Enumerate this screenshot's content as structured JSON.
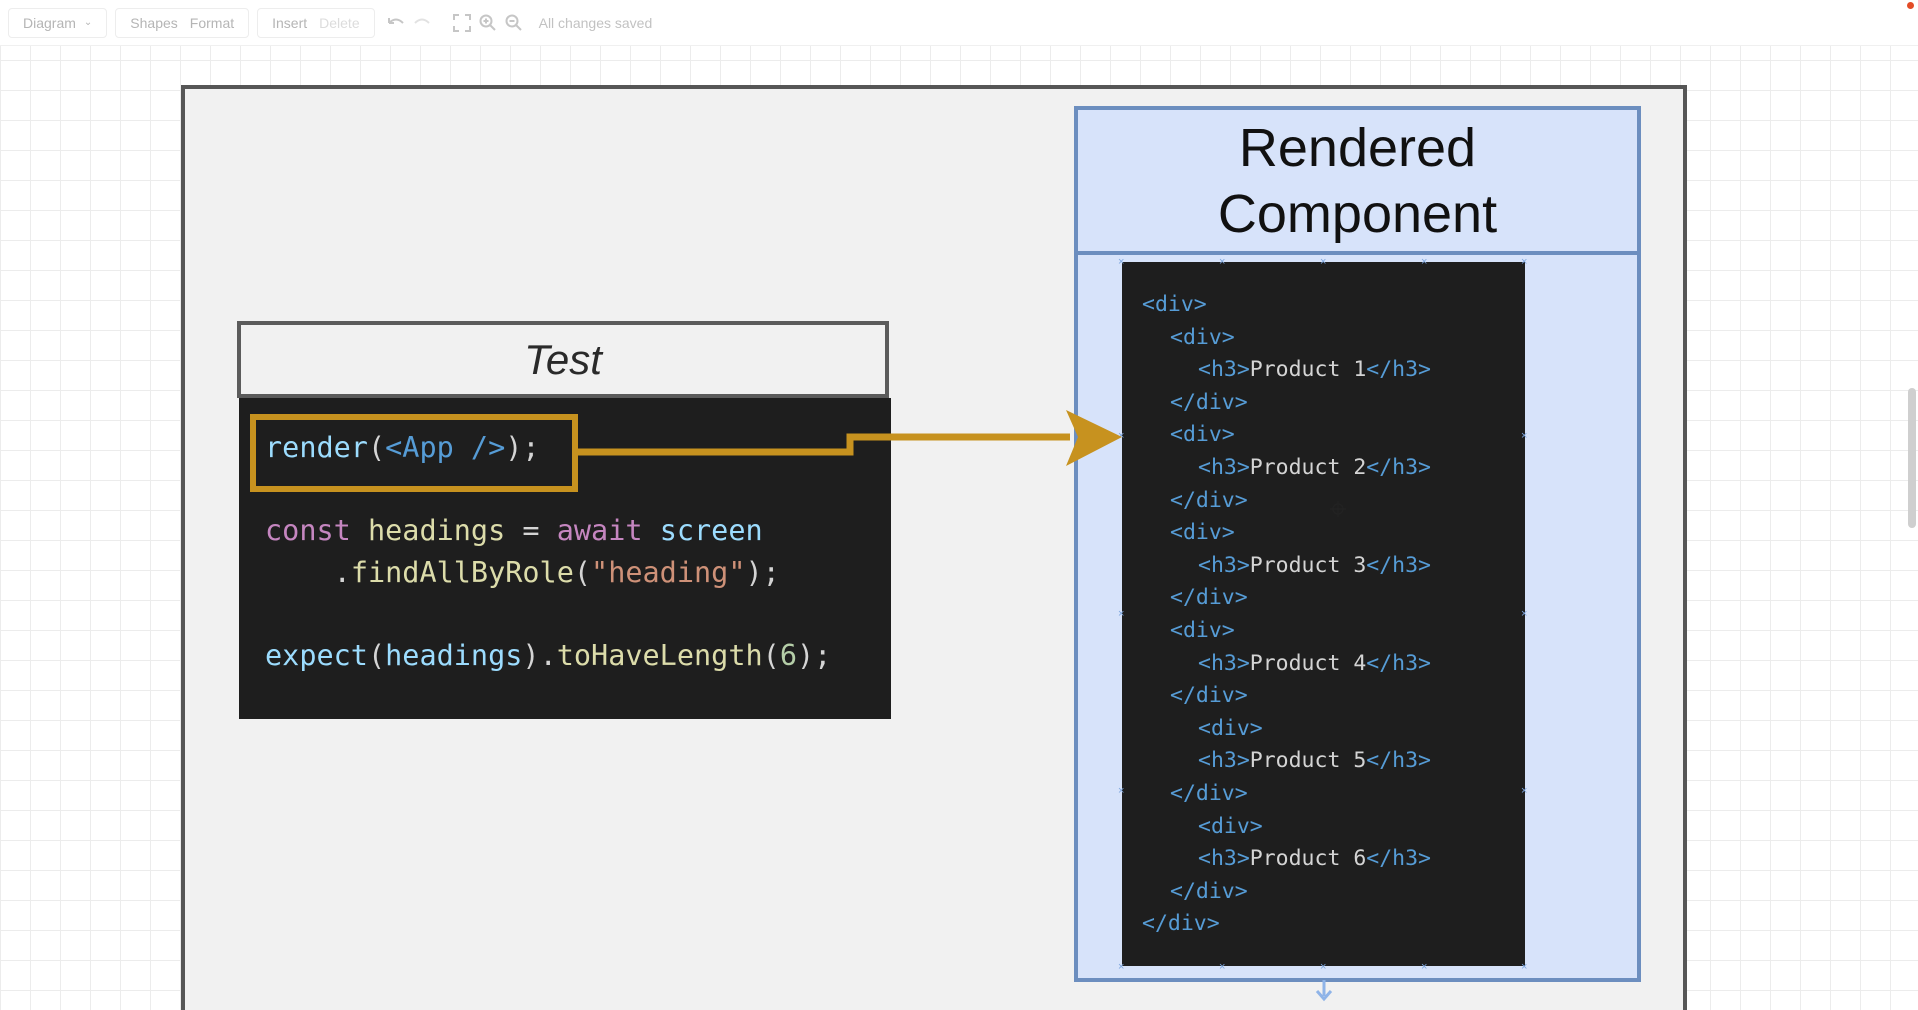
{
  "toolbar": {
    "diagram_menu": "Diagram",
    "shapes_label": "Shapes",
    "format_label": "Format",
    "insert_label": "Insert",
    "delete_label": "Delete",
    "undo_icon": "undo-icon",
    "redo_icon": "redo-icon",
    "fullscreen_icon": "fullscreen-icon",
    "zoom_in_icon": "zoom-in-icon",
    "zoom_out_icon": "zoom-out-icon",
    "status": "All changes saved"
  },
  "test_panel": {
    "title": "Test",
    "code": {
      "line1": {
        "fn": "render",
        "open": "(",
        "tag": "<App />",
        "close": ");"
      },
      "line2": {
        "kw_const": "const",
        "var": "headings",
        "eq": " = ",
        "kw_await": "await",
        "obj": "screen"
      },
      "line3": {
        "dot": ".",
        "method": "findAllByRole",
        "open": "(",
        "str": "\"heading\"",
        "close": ");"
      },
      "line4": {
        "fn": "expect",
        "open": "(",
        "arg": "headings",
        "mid": ").",
        "method": "toHaveLength",
        "open2": "(",
        "num": "6",
        "close": ");"
      }
    }
  },
  "rendered_panel": {
    "title_line1": "Rendered",
    "title_line2": "Component",
    "dom_lines": [
      {
        "tag_open": "<div>"
      },
      {
        "tag_open": "<div>"
      },
      {
        "tag_open": "<h3>",
        "text": "Product 1",
        "tag_close": "</h3>"
      },
      {
        "tag_open": "</div>"
      },
      {
        "tag_open": "<div>"
      },
      {
        "tag_open": "<h3>",
        "text": "Product 2",
        "tag_close": "</h3>"
      },
      {
        "tag_open": "</div>"
      },
      {
        "tag_open": "<div>"
      },
      {
        "tag_open": "<h3>",
        "text": "Product 3",
        "tag_close": "</h3>"
      },
      {
        "tag_open": "</div>"
      },
      {
        "tag_open": "<div>"
      },
      {
        "tag_open": "<h3>",
        "text": "Product 4",
        "tag_close": "</h3>"
      },
      {
        "tag_open": "</div>"
      },
      {
        "tag_open": "<div>"
      },
      {
        "tag_open": "<h3>",
        "text": "Product 5",
        "tag_close": "</h3>"
      },
      {
        "tag_open": "</div>"
      },
      {
        "tag_open": "<div>"
      },
      {
        "tag_open": "<h3>",
        "text": "Product 6",
        "tag_close": "</h3>"
      },
      {
        "tag_open": "</div>"
      },
      {
        "tag_open": "</div>"
      }
    ]
  },
  "colors": {
    "highlight": "#c7921f",
    "panel_fill": "#d7e3fa",
    "panel_border": "#6c8ebf",
    "code_bg": "#1e1e1e"
  }
}
